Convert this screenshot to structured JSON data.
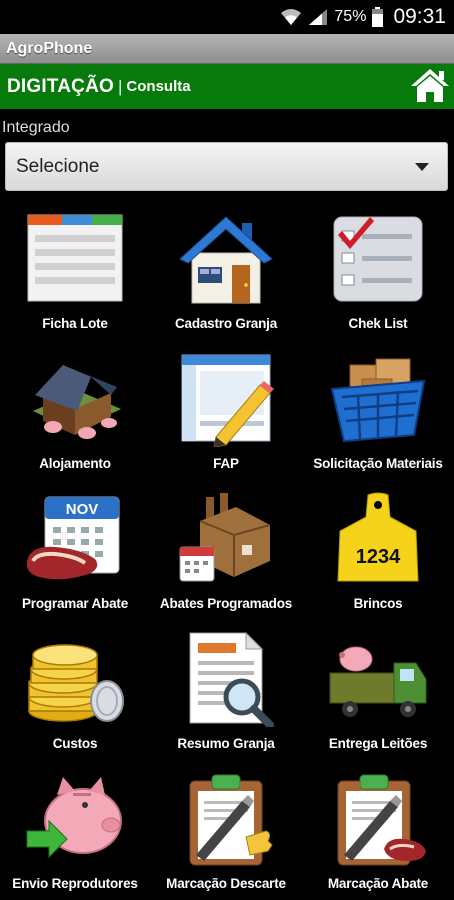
{
  "status_bar": {
    "battery_percent": "75%",
    "time": "09:31"
  },
  "app": {
    "title": "AgroPhone"
  },
  "header": {
    "title": "DIGITAÇÃO",
    "separator": "|",
    "link": "Consulta"
  },
  "integrado": {
    "label": "Integrado",
    "select_value": "Selecione"
  },
  "tiles": [
    {
      "label": "Ficha Lote",
      "icon": "form-sheet-icon"
    },
    {
      "label": "Cadastro Granja",
      "icon": "house-icon"
    },
    {
      "label": "Chek List",
      "icon": "checklist-icon"
    },
    {
      "label": "Alojamento",
      "icon": "pig-barn-icon"
    },
    {
      "label": "FAP",
      "icon": "document-pencil-icon"
    },
    {
      "label": "Solicitação Materiais",
      "icon": "basket-boxes-icon"
    },
    {
      "label": "Programar Abate",
      "icon": "calendar-meat-icon"
    },
    {
      "label": "Abates Programados",
      "icon": "factory-calendar-icon"
    },
    {
      "label": "Brincos",
      "icon": "ear-tag-icon"
    },
    {
      "label": "Custos",
      "icon": "coins-icon"
    },
    {
      "label": "Resumo Granja",
      "icon": "report-magnifier-icon"
    },
    {
      "label": "Entrega Leitões",
      "icon": "truck-pig-icon"
    },
    {
      "label": "Envio Reprodutores",
      "icon": "piggy-arrow-icon"
    },
    {
      "label": "Marcação Descarte",
      "icon": "clipboard-thumb-icon"
    },
    {
      "label": "Marcação Abate",
      "icon": "clipboard-meat-icon"
    }
  ],
  "brincos_tag_number": "1234",
  "calendar_month": "NOV",
  "colors": {
    "header_green": "#087a0b",
    "background": "#000000",
    "title_bar": "#9e9e9e"
  }
}
